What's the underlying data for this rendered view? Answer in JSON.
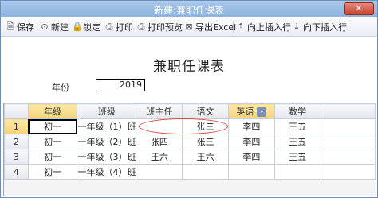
{
  "window": {
    "title": "新建:兼职任课表",
    "close_glyph": "✕"
  },
  "toolbar": {
    "items": [
      {
        "label": "保存",
        "icon": "save-icon",
        "glyph": "🗎"
      },
      {
        "label": "新建",
        "icon": "new-icon",
        "glyph": "⊙"
      },
      {
        "label": "锁定",
        "icon": "lock-icon",
        "glyph": "🔒"
      },
      {
        "label": "打印",
        "icon": "print-icon",
        "glyph": "⎙"
      },
      {
        "label": "打印预览",
        "icon": "print-preview-icon",
        "glyph": "⎙"
      },
      {
        "label": "导出Excel",
        "icon": "excel-icon",
        "glyph": "⊠"
      },
      {
        "label": "向上插入行",
        "icon": "insert-above-icon",
        "glyph": "⇡"
      },
      {
        "label": "向下插入行",
        "icon": "insert-below-icon",
        "glyph": "⇣"
      }
    ]
  },
  "form": {
    "doc_title": "兼职任课表",
    "year_label": "年份",
    "year_value": "2019"
  },
  "grid": {
    "columns": [
      "年级",
      "班级",
      "班主任",
      "语文",
      "英语",
      "数学"
    ],
    "rows": [
      {
        "num": "1",
        "cells": [
          "初一",
          "一年级（1）班",
          "",
          "张三",
          "李四",
          "王五"
        ]
      },
      {
        "num": "2",
        "cells": [
          "初一",
          "一年级（2）班",
          "张四",
          "张三",
          "李四",
          "王五"
        ]
      },
      {
        "num": "3",
        "cells": [
          "初一",
          "一年级（3）班",
          "王六",
          "王六",
          "李四",
          "王五"
        ]
      },
      {
        "num": "4",
        "cells": [
          "初一",
          "一年级（4）班",
          "",
          "",
          "",
          ""
        ]
      }
    ]
  },
  "colors": {
    "accent": "#f5d27a",
    "highlight_ring": "#d94040"
  }
}
